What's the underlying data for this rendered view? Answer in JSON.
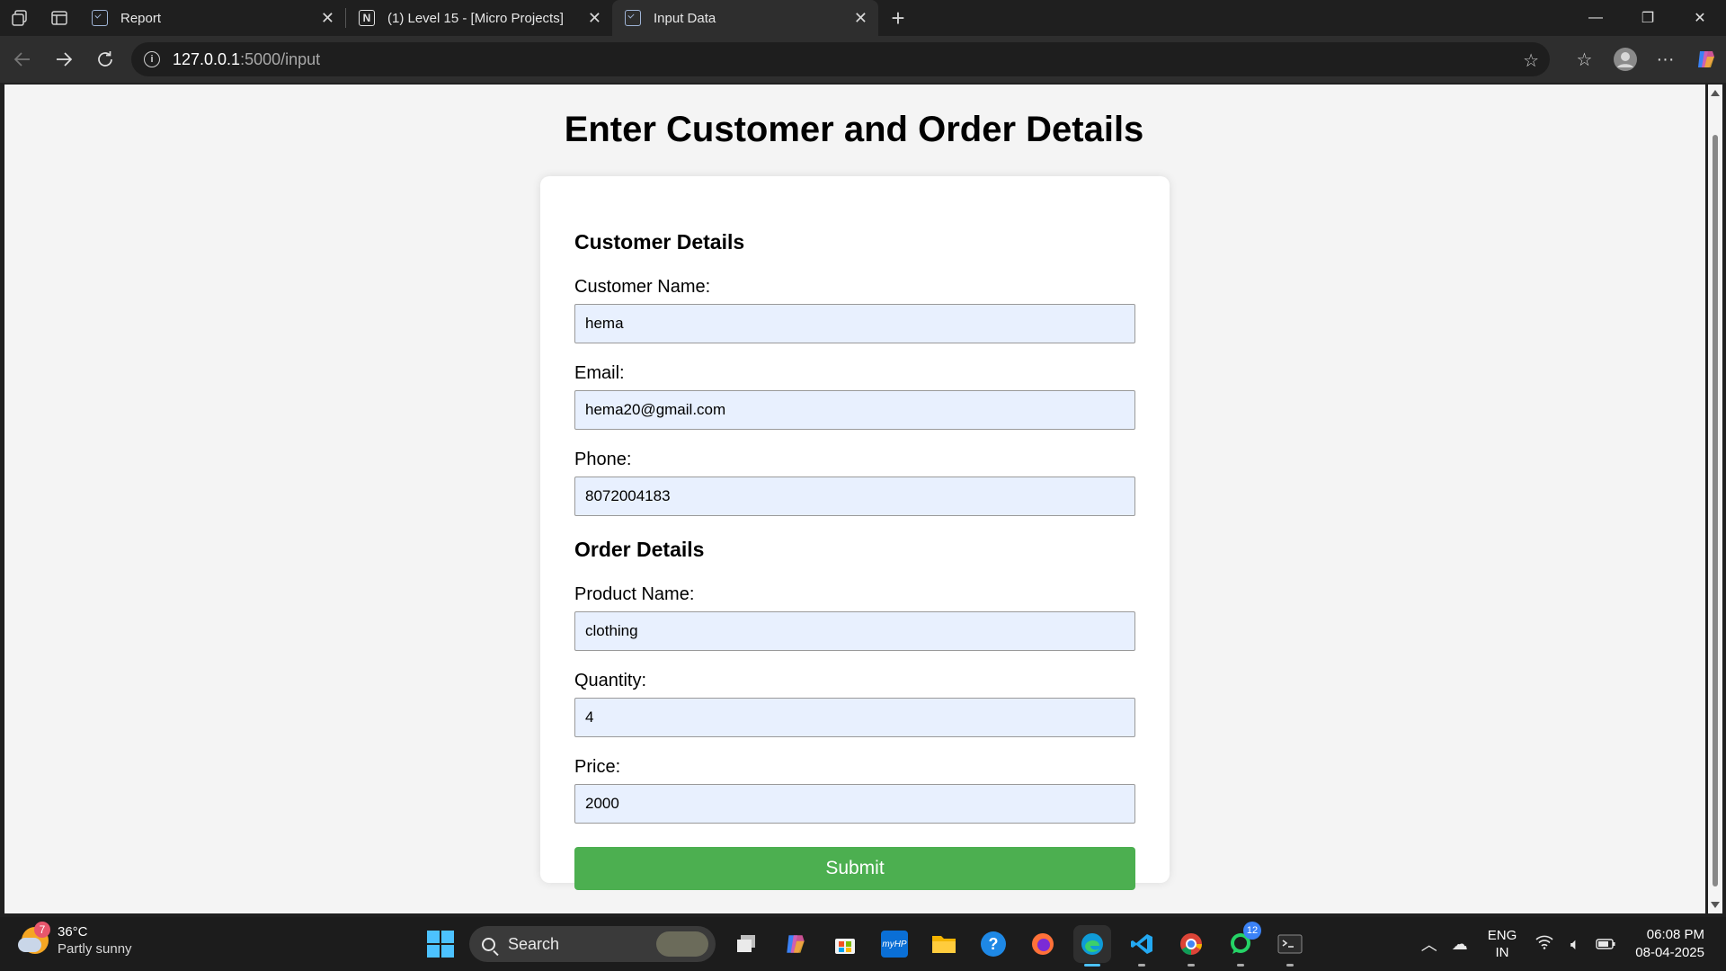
{
  "browser": {
    "tabs": [
      {
        "title": "Report",
        "active": false
      },
      {
        "title": "(1) Level 15 - [Micro Projects]",
        "active": false
      },
      {
        "title": "Input Data",
        "active": true
      }
    ],
    "url_host": "127.0.0.1",
    "url_path": ":5000/input"
  },
  "page": {
    "title": "Enter Customer and Order Details",
    "customer_section": "Customer Details",
    "order_section": "Order Details",
    "fields": {
      "customer_name": {
        "label": "Customer Name:",
        "value": "hema"
      },
      "email": {
        "label": "Email:",
        "value": "hema20@gmail.com"
      },
      "phone": {
        "label": "Phone:",
        "value": "8072004183"
      },
      "product_name": {
        "label": "Product Name:",
        "value": "clothing"
      },
      "quantity": {
        "label": "Quantity:",
        "value": "4"
      },
      "price": {
        "label": "Price:",
        "value": "2000"
      }
    },
    "submit_label": "Submit",
    "submit_color": "#4caf50",
    "input_bg": "#e8f0fe"
  },
  "taskbar": {
    "weather_badge": "7",
    "temperature": "36°C",
    "condition": "Partly sunny",
    "search_label": "Search",
    "apps": [
      "file-explorer-window",
      "copilot",
      "microsoft-store",
      "hp-app",
      "file-explorer",
      "get-help",
      "firefox",
      "edge",
      "vscode",
      "chrome",
      "whatsapp",
      "terminal"
    ],
    "chrome_badge": "",
    "whatsapp_badge": "12",
    "lang_line1": "ENG",
    "lang_line2": "IN",
    "time": "06:08 PM",
    "date": "08-04-2025"
  }
}
